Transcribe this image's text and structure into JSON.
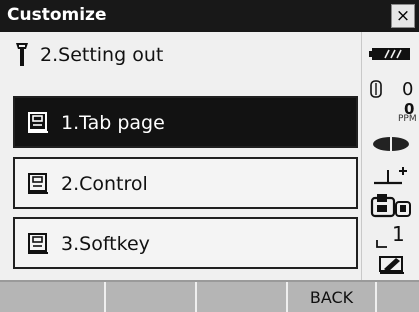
{
  "window": {
    "title": "Customize",
    "close_glyph": "×"
  },
  "header": {
    "icon": "survey-pole-icon",
    "text": "2.Setting out"
  },
  "menu": {
    "selected_index": 0,
    "items": [
      {
        "label": "1.Tab page",
        "icon": "book-icon"
      },
      {
        "label": "2.Control",
        "icon": "book-icon"
      },
      {
        "label": "3.Softkey",
        "icon": "book-icon"
      }
    ]
  },
  "status": {
    "battery_icon": "battery-icon",
    "prism_constant": "0",
    "ppm_value": "0",
    "ppm_unit": "PPM",
    "target_icon": "target-icon",
    "tilt_icon": "tilt-icon",
    "mode_icon": "bluetooth-device-icon",
    "face_value": "1",
    "input_mode_icon": "input-mode-icon"
  },
  "softkeys": [
    "",
    "",
    "",
    "BACK",
    ""
  ],
  "colors": {
    "titlebar": "#181818",
    "selected": "#121212",
    "softkey": "#b5b5b5"
  }
}
